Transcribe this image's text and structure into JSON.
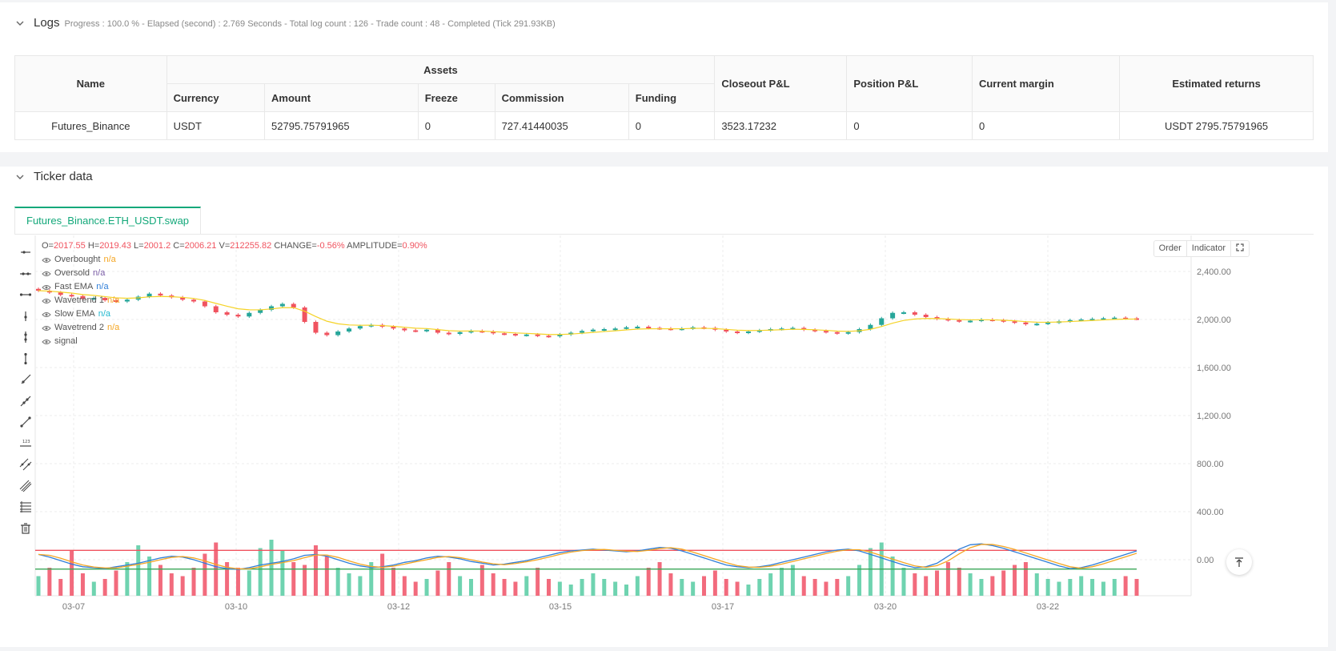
{
  "logs": {
    "title": "Logs",
    "progress": "Progress : 100.0 % - Elapsed (second) : 2.769  Seconds - Total log count : 126 - Trade count : 48 - Completed (Tick 291.93KB)",
    "table": {
      "col_name": "Name",
      "col_assets": "Assets",
      "col_currency": "Currency",
      "col_amount": "Amount",
      "col_freeze": "Freeze",
      "col_commission": "Commission",
      "col_funding": "Funding",
      "col_closeout": "Closeout P&L",
      "col_position": "Position P&L",
      "col_margin": "Current margin",
      "col_returns": "Estimated returns",
      "row": {
        "name": "Futures_Binance",
        "currency": "USDT",
        "amount": "52795.75791965",
        "freeze": "0",
        "commission": "727.41440035",
        "funding": "0",
        "closeout": "3523.17232",
        "position": "0",
        "margin": "0",
        "returns": "USDT 2795.75791965"
      }
    }
  },
  "ticker": {
    "title": "Ticker data",
    "tab": "Futures_Binance.ETH_USDT.swap",
    "buttons": {
      "order": "Order",
      "indicator": "Indicator"
    },
    "ohlc": {
      "o_label": "O=",
      "o": "2017.55",
      "h_label": "H=",
      "h": "2019.43",
      "l_label": "L=",
      "l": "2001.2",
      "c_label": "C=",
      "c": "2006.21",
      "v_label": "V=",
      "v": "212255.82",
      "change_label": "CHANGE=",
      "change": "-0.56%",
      "amp_label": "AMPLITUDE=",
      "amp": "0.90%"
    },
    "indicators": [
      {
        "name": "Overbought",
        "value": "n/a",
        "color": "#f5a623"
      },
      {
        "name": "Oversold",
        "value": "n/a",
        "color": "#7b5ea7"
      },
      {
        "name": "Fast EMA",
        "value": "n/a",
        "color": "#2f7ed8"
      },
      {
        "name": "Wavetrend 1",
        "value": "n/a",
        "color": "#f5a623"
      },
      {
        "name": "Slow EMA",
        "value": "n/a",
        "color": "#22b8cf"
      },
      {
        "name": "Wavetrend 2",
        "value": "n/a",
        "color": "#f5a623"
      },
      {
        "name": "signal",
        "value": "",
        "color": "#555555"
      }
    ],
    "toolbar_icons": [
      "horizontal-ray-icon",
      "horizontal-line-icon",
      "horizontal-segment-icon",
      "vertical-ray-icon",
      "vertical-line-icon",
      "vertical-segment-icon",
      "ray-icon",
      "extended-line-icon",
      "trend-line-icon",
      "price-label-icon",
      "parallel-channel-icon",
      "pitchfork-icon",
      "fib-retracement-icon",
      "trash-icon"
    ]
  },
  "chart_data": {
    "type": "candlestick",
    "x_ticks": [
      "03-07",
      "03-10",
      "03-12",
      "03-15",
      "03-17",
      "03-20",
      "03-22"
    ],
    "y_ticks": [
      "2,400.00",
      "2,000.00",
      "1,600.00",
      "1,200.00",
      "800.00",
      "400.00",
      "0.00"
    ],
    "ylim": [
      -300,
      2700
    ],
    "colors": {
      "up": "#26a69a",
      "down": "#f0535f",
      "ema": "#f5d327",
      "overbought": "#f0535f",
      "oversold": "#3aa757",
      "wt1": "#2f7ed8",
      "wt2": "#f5a623"
    },
    "price_close": [
      2240,
      2225,
      2205,
      2195,
      2170,
      2180,
      2160,
      2150,
      2165,
      2190,
      2215,
      2200,
      2185,
      2165,
      2150,
      2110,
      2060,
      2040,
      2025,
      2055,
      2080,
      2110,
      2130,
      2100,
      1980,
      1890,
      1870,
      1900,
      1925,
      1945,
      1955,
      1940,
      1925,
      1910,
      1905,
      1915,
      1890,
      1880,
      1895,
      1905,
      1900,
      1885,
      1880,
      1870,
      1875,
      1865,
      1860,
      1875,
      1890,
      1905,
      1915,
      1920,
      1925,
      1935,
      1940,
      1930,
      1925,
      1920,
      1925,
      1935,
      1930,
      1915,
      1900,
      1890,
      1900,
      1910,
      1920,
      1925,
      1930,
      1915,
      1905,
      1895,
      1885,
      1895,
      1920,
      1955,
      2010,
      2055,
      2060,
      2040,
      2020,
      2005,
      1995,
      1985,
      1990,
      2000,
      1995,
      1985,
      1975,
      1960,
      1965,
      1975,
      1985,
      1995,
      2000,
      2005,
      2010,
      2015,
      2010,
      2006
    ],
    "volume_signal": [
      0.35,
      0.5,
      0.3,
      0.8,
      0.4,
      0.25,
      0.3,
      0.45,
      0.6,
      0.9,
      0.7,
      0.55,
      0.4,
      0.35,
      0.5,
      0.75,
      0.95,
      0.6,
      0.5,
      0.45,
      0.85,
      1.0,
      0.8,
      0.6,
      0.55,
      0.9,
      0.7,
      0.5,
      0.4,
      0.35,
      0.6,
      0.75,
      0.5,
      0.35,
      0.25,
      0.3,
      0.45,
      0.6,
      0.35,
      0.3,
      0.55,
      0.4,
      0.3,
      0.25,
      0.35,
      0.5,
      0.3,
      0.25,
      0.2,
      0.3,
      0.4,
      0.3,
      0.25,
      0.2,
      0.35,
      0.5,
      0.6,
      0.4,
      0.3,
      0.25,
      0.35,
      0.45,
      0.3,
      0.25,
      0.2,
      0.3,
      0.4,
      0.5,
      0.55,
      0.35,
      0.3,
      0.25,
      0.3,
      0.35,
      0.55,
      0.85,
      0.95,
      0.7,
      0.5,
      0.4,
      0.35,
      0.45,
      0.6,
      0.5,
      0.4,
      0.3,
      0.35,
      0.45,
      0.55,
      0.6,
      0.4,
      0.3,
      0.25,
      0.3,
      0.35,
      0.3,
      0.25,
      0.3,
      0.35,
      0.3
    ],
    "overbought_level": 53,
    "oversold_level": -53,
    "wt1": [
      30,
      15,
      -5,
      -25,
      -40,
      -45,
      -50,
      -40,
      -30,
      -20,
      -5,
      10,
      20,
      15,
      0,
      -20,
      -40,
      -50,
      -55,
      -45,
      -30,
      -20,
      -10,
      5,
      25,
      30,
      20,
      0,
      -20,
      -35,
      -45,
      -40,
      -30,
      -15,
      -5,
      10,
      20,
      15,
      5,
      -10,
      -20,
      -30,
      -25,
      -15,
      -5,
      10,
      25,
      40,
      50,
      55,
      60,
      55,
      50,
      45,
      50,
      60,
      70,
      65,
      50,
      30,
      10,
      -10,
      -30,
      -40,
      -45,
      -40,
      -30,
      -15,
      0,
      15,
      30,
      45,
      55,
      60,
      50,
      30,
      10,
      -10,
      -30,
      -45,
      -40,
      -20,
      20,
      60,
      85,
      90,
      80,
      65,
      45,
      25,
      5,
      -15,
      -35,
      -50,
      -45,
      -30,
      -10,
      10,
      30,
      50
    ]
  }
}
